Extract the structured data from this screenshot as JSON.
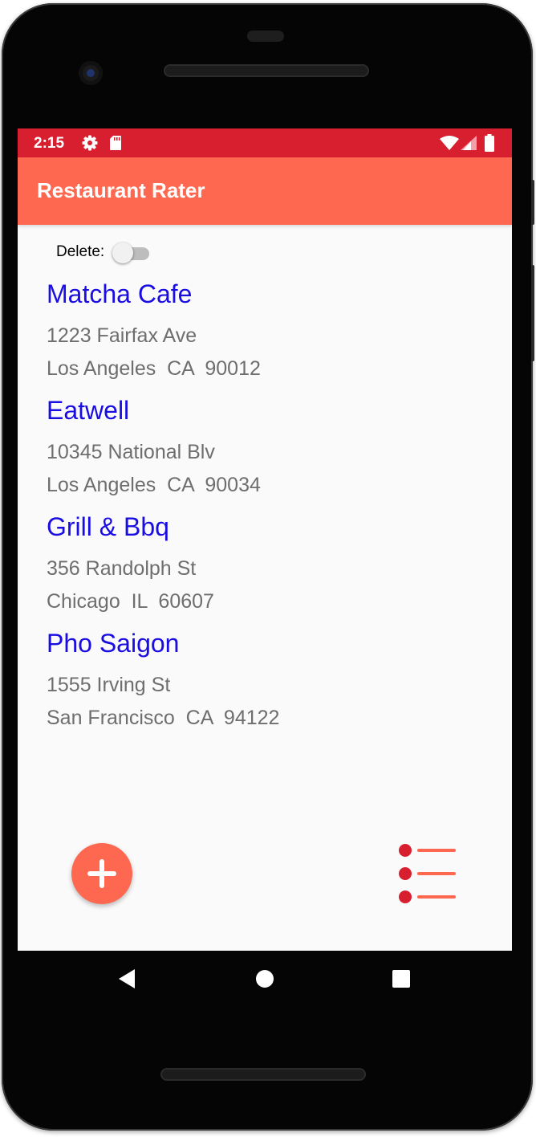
{
  "status_bar": {
    "time": "2:15",
    "icons": [
      "gear-icon",
      "sd-card-icon",
      "wifi-icon",
      "cell-signal-icon",
      "battery-icon"
    ]
  },
  "app_bar": {
    "title": "Restaurant Rater"
  },
  "delete_toggle": {
    "label": "Delete:",
    "checked": false
  },
  "restaurants": [
    {
      "name": "Matcha Cafe",
      "street": "1223 Fairfax Ave",
      "city_line": "Los Angeles  CA  90012"
    },
    {
      "name": "Eatwell",
      "street": "10345 National Blv",
      "city_line": "Los Angeles  CA  90034"
    },
    {
      "name": "Grill & Bbq",
      "street": "356 Randolph St",
      "city_line": "Chicago  IL  60607"
    },
    {
      "name": "Pho Saigon",
      "street": "1555 Irving St",
      "city_line": "San Francisco  CA  94122"
    }
  ],
  "bottom_buttons": {
    "add_icon": "plus-icon",
    "list_icon": "list-icon"
  },
  "nav_bar": {
    "icons": [
      "back-triangle-icon",
      "home-circle-icon",
      "recents-square-icon"
    ]
  },
  "colors": {
    "status_bar": "#d81f2f",
    "app_bar": "#fe6850",
    "restaurant_name": "#1a0de2",
    "address_text": "#6e6e6e",
    "list_dot": "#d81f2f"
  }
}
